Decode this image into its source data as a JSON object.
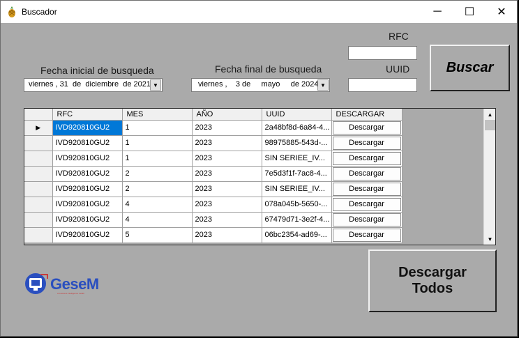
{
  "window": {
    "title": "Buscador",
    "icon": "pineapple-icon",
    "controls": {
      "minimize": "─",
      "maximize": "☐",
      "close": "✕"
    }
  },
  "labels": {
    "fecha_inicial": "Fecha inicial de busqueda",
    "fecha_final": "Fecha final de busqueda",
    "rfc": "RFC",
    "uuid": "UUID"
  },
  "fecha_inicial": {
    "dia": "viernes",
    "num": "31",
    "de1": "de",
    "mes": "diciembre",
    "de2": "de",
    "anio": "2021"
  },
  "fecha_final": {
    "dia": "viernes",
    "num": "3",
    "de1": "de",
    "mes": "mayo",
    "de2": "de",
    "anio": "2024"
  },
  "inputs": {
    "rfc": "",
    "uuid": ""
  },
  "buttons": {
    "buscar": "Buscar",
    "descargar_todos_1": "Descargar",
    "descargar_todos_2": "Todos"
  },
  "grid": {
    "columns": [
      "RFC",
      "MES",
      "AÑO",
      "UUID",
      "DESCARGAR"
    ],
    "row_button": "Descargar",
    "rows": [
      {
        "rfc": "IVD920810GU2",
        "mes": "1",
        "anio": "2023",
        "uuid": "2a48bf8d-6a84-4..."
      },
      {
        "rfc": "IVD920810GU2",
        "mes": "1",
        "anio": "2023",
        "uuid": "98975885-543d-..."
      },
      {
        "rfc": "IVD920810GU2",
        "mes": "1",
        "anio": "2023",
        "uuid": "SIN SERIEE_IV..."
      },
      {
        "rfc": "IVD920810GU2",
        "mes": "2",
        "anio": "2023",
        "uuid": "7e5d3f1f-7ac8-4..."
      },
      {
        "rfc": "IVD920810GU2",
        "mes": "2",
        "anio": "2023",
        "uuid": "SIN SERIEE_IV..."
      },
      {
        "rfc": "IVD920810GU2",
        "mes": "4",
        "anio": "2023",
        "uuid": "078a045b-5650-..."
      },
      {
        "rfc": "IVD920810GU2",
        "mes": "4",
        "anio": "2023",
        "uuid": "67479d71-3e2f-4..."
      },
      {
        "rfc": "IVD920810GU2",
        "mes": "5",
        "anio": "2023",
        "uuid": "06bc2354-ad69-..."
      }
    ]
  },
  "logo": {
    "text": "GeseM",
    "sub": "a business intelligence toolkit"
  },
  "colors": {
    "window_bg": "#aaaaaa",
    "selection": "#0078d7",
    "logo": "#2a4fbf"
  }
}
